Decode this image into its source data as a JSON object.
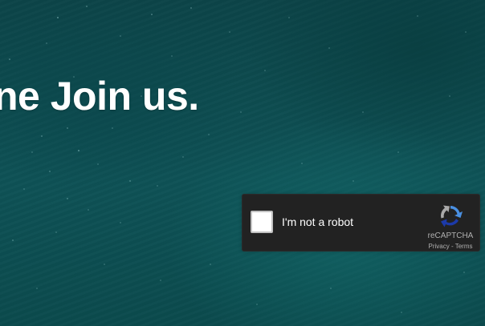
{
  "hero": {
    "headline": "ne Join us."
  },
  "recaptcha": {
    "checkbox_label": "I'm not a robot",
    "checked": false,
    "brand": "reCAPTCHA",
    "privacy_link": "Privacy",
    "separator": " - ",
    "terms_link": "Terms",
    "logo_icon": "recaptcha-logo-icon"
  },
  "colors": {
    "background": "#0d4a4d",
    "widget_background": "#222222",
    "headline_text": "#ffffff",
    "logo_blue": "#4a90e2",
    "logo_dark_blue": "#1c3aa9",
    "logo_gray": "#aaaaaa"
  }
}
